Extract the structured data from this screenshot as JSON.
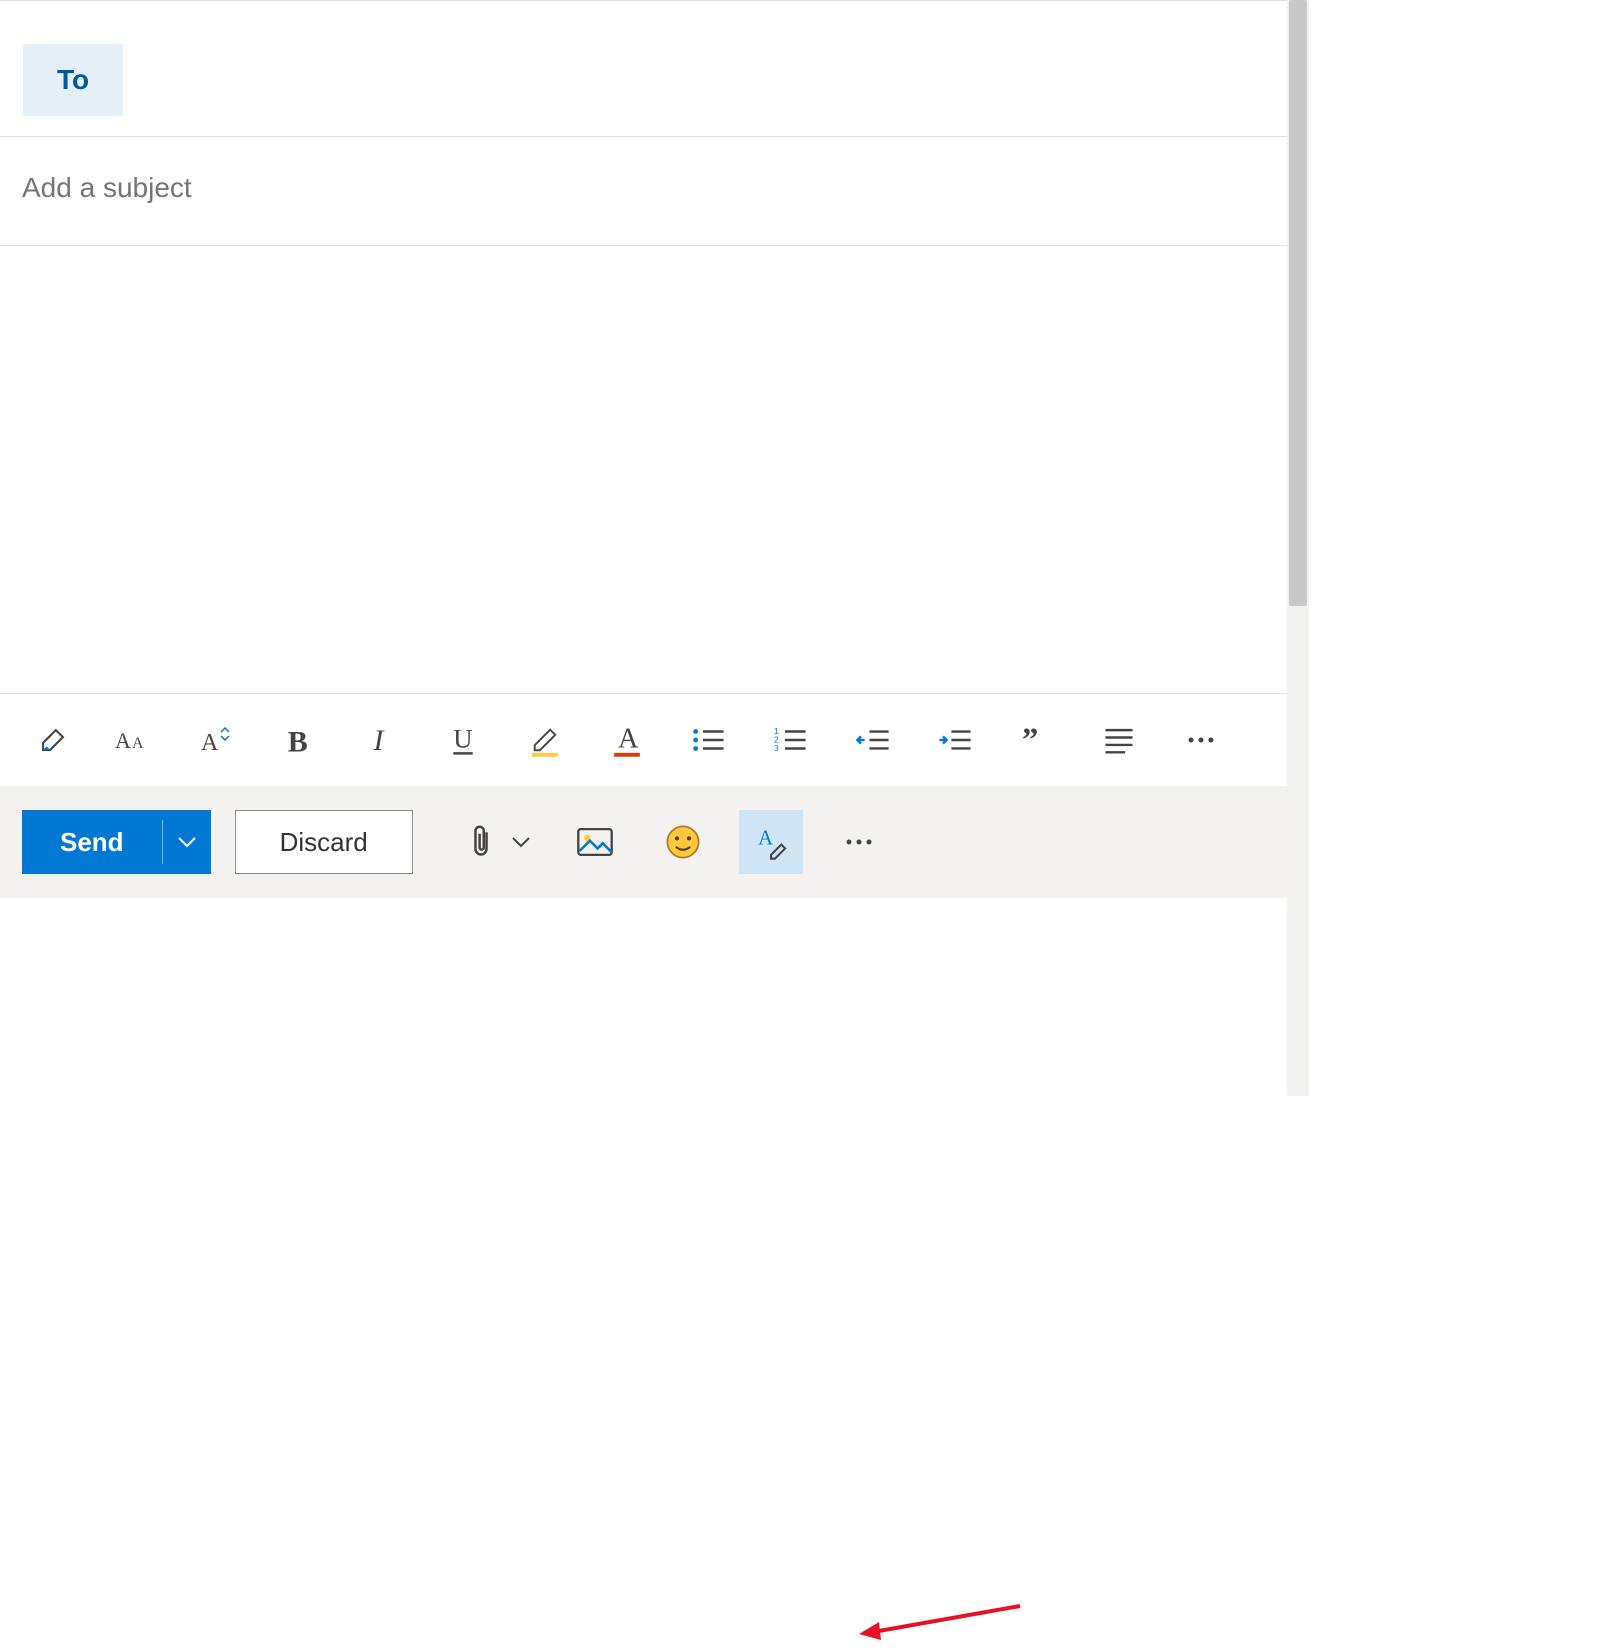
{
  "to_label": "To",
  "subject_placeholder": "Add a subject",
  "send_label": "Send",
  "discard_label": "Discard",
  "colors": {
    "primary": "#0078d4",
    "accent_text": "#005a9e",
    "accent_bg": "#e5eff8"
  },
  "format_toolbar": [
    "format-painter",
    "font-case",
    "font-size",
    "bold",
    "italic",
    "underline",
    "highlight",
    "font-color",
    "bullets",
    "numbering",
    "decrease-indent",
    "increase-indent",
    "quote",
    "alignment",
    "more"
  ],
  "send_bar_actions": [
    "attach",
    "attach-chevron",
    "insert-picture",
    "emoji",
    "editor",
    "more-actions"
  ]
}
